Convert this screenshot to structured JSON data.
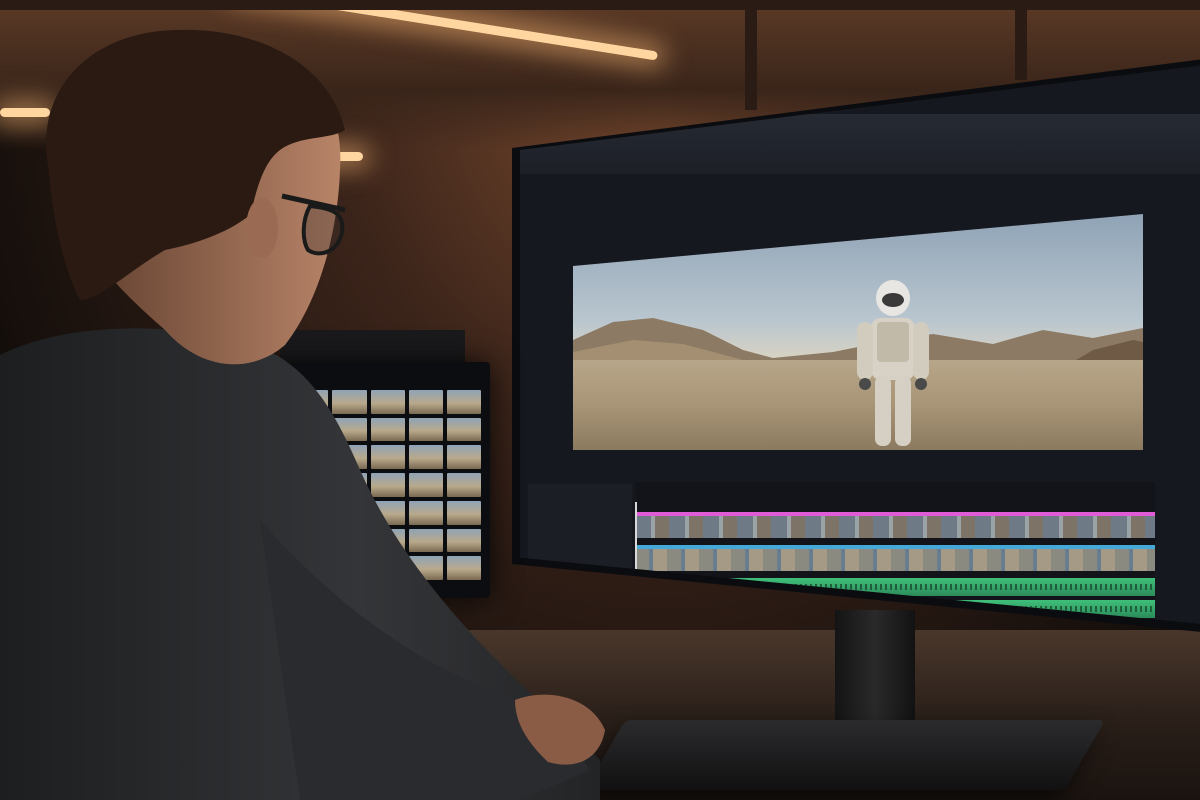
{
  "scene": {
    "colors": {
      "warm_light": "#ffd6a0",
      "wall": "#3b241a",
      "shirt": "#2f3033",
      "hair": "#2b1a12",
      "skin": "#b88468",
      "clip_magenta": "#e05bd6",
      "clip_blue": "#45a8d6",
      "audio_green": "#3fbf7a"
    },
    "icons": [
      "person-silhouette",
      "eyeglasses",
      "astronaut-figure",
      "desert-mountains"
    ]
  }
}
